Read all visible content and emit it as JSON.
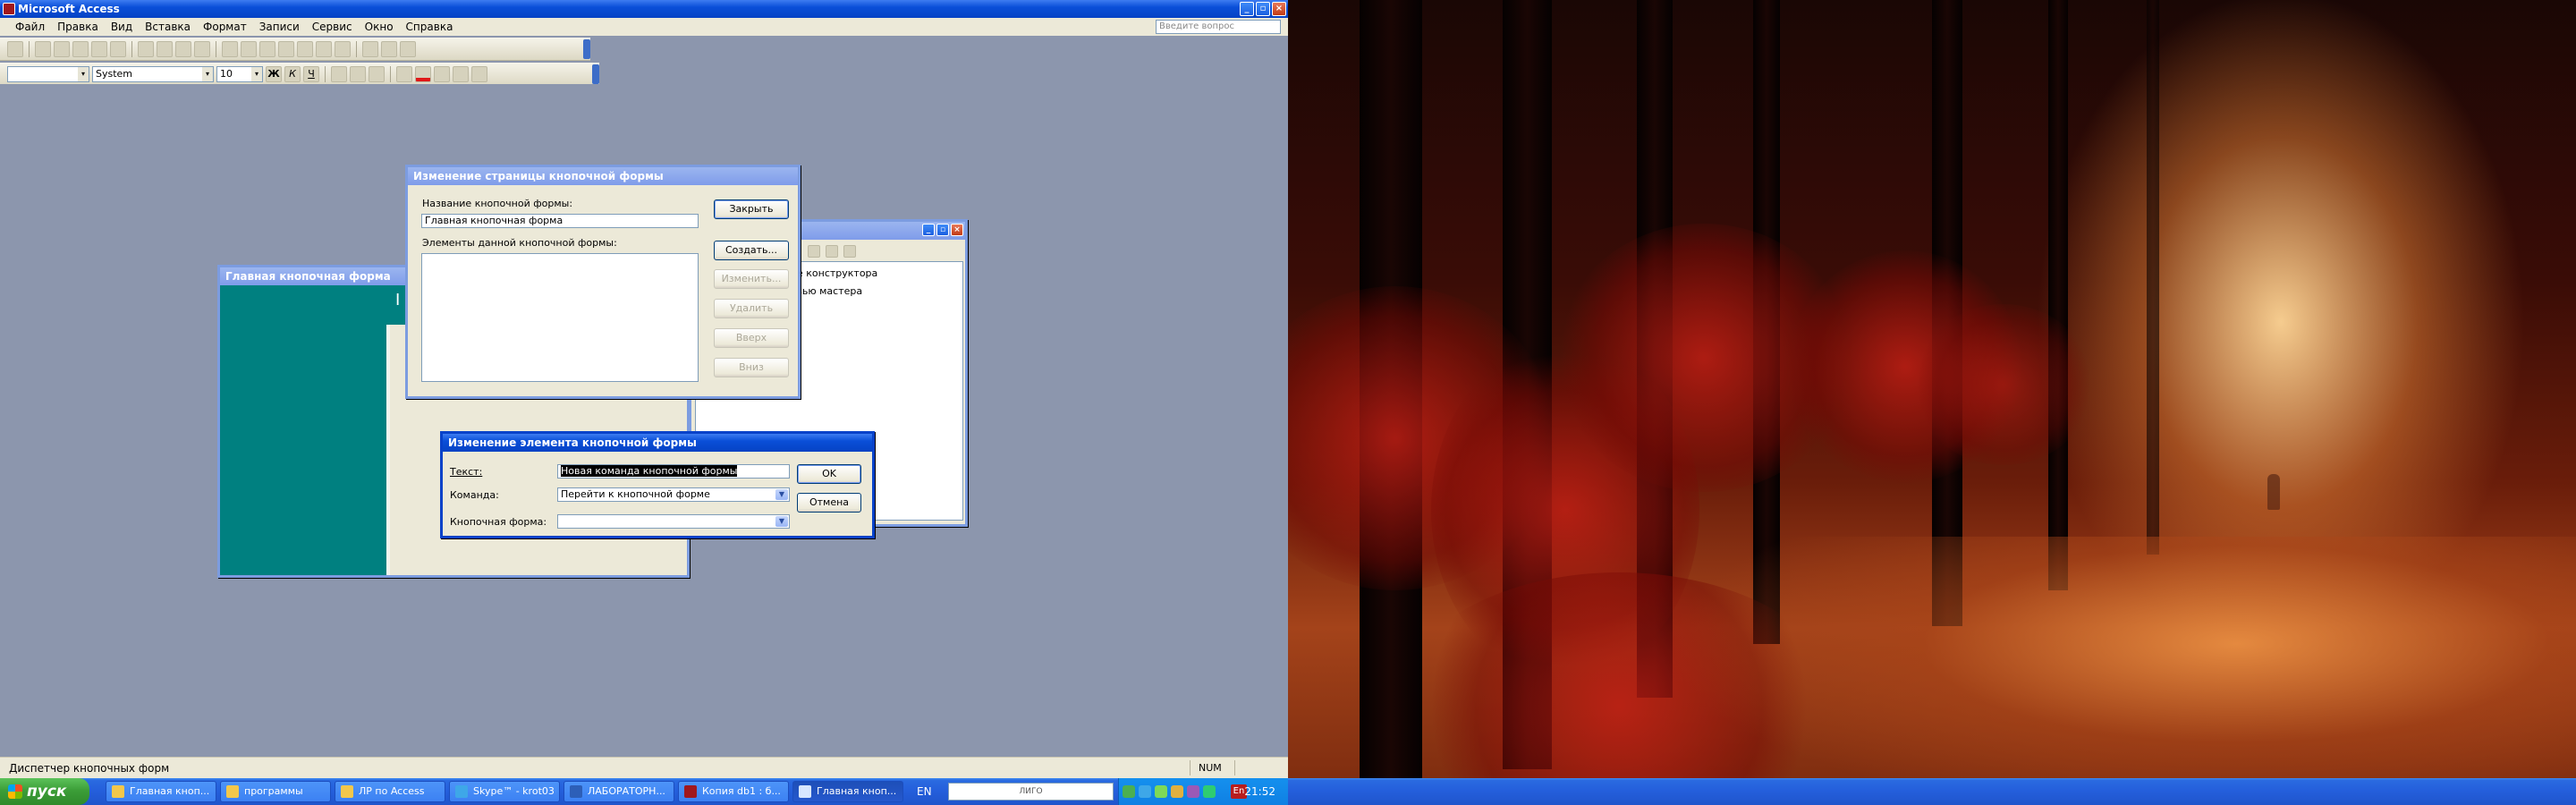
{
  "window": {
    "title": "Microsoft Access"
  },
  "menu": {
    "items": [
      "Файл",
      "Правка",
      "Вид",
      "Вставка",
      "Формат",
      "Записи",
      "Сервис",
      "Окно",
      "Справка"
    ],
    "ask_placeholder": "Введите вопрос"
  },
  "formatting": {
    "font": "System",
    "size": "10"
  },
  "status": {
    "text": "Диспетчер кнопочных форм",
    "num": "NUM"
  },
  "form_main": {
    "title": "Главная кнопочная форма",
    "caption_char": "I"
  },
  "switchboard_list": {
    "items": [
      "е конструктора",
      "зью мастера"
    ]
  },
  "page_dialog": {
    "title": "Изменение страницы кнопочной формы",
    "name_label": "Название кнопочной формы:",
    "name_value": "Главная кнопочная форма",
    "items_label": "Элементы данной кнопочной формы:",
    "buttons": {
      "close": "Закрыть",
      "create": "Создать...",
      "edit": "Изменить...",
      "delete": "Удалить",
      "up": "Вверх",
      "down": "Вниз"
    }
  },
  "item_dialog": {
    "title": "Изменение элемента кнопочной формы",
    "text_label": "Текст:",
    "text_value": "Новая команда кнопочной формы",
    "command_label": "Команда:",
    "command_value": "Перейти к кнопочной форме",
    "form_label": "Кнопочная форма:",
    "form_value": "",
    "ok": "OK",
    "cancel": "Отмена"
  },
  "taskbar": {
    "start": "пуск",
    "tasks": [
      "Главная кноп...",
      "программы",
      "ЛР по Access",
      "Skype™ - krot03",
      "ЛАБОРАТОРН...",
      "Копия db1 : б...",
      "Главная кноп..."
    ],
    "lang": "EN",
    "search_hint": "ЛИГО",
    "tray_lang": "En",
    "clock": "21:52"
  },
  "colors": {
    "xp_blue": "#0842c9",
    "teal": "#008080",
    "mdi_bg": "#8c96ad"
  }
}
